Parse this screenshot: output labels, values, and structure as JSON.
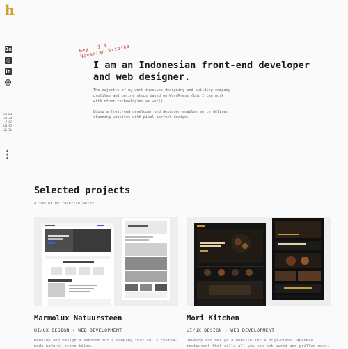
{
  "logo": "h",
  "social": [
    {
      "icon": "behance-icon",
      "glyph": "Bē"
    },
    {
      "icon": "github-icon",
      "glyph": "◎"
    },
    {
      "icon": "linkedin-icon",
      "glyph": "in"
    },
    {
      "icon": "at-icon",
      "glyph": "@"
    }
  ],
  "sidebar_vertical_text": "HELLO WORLD",
  "hero": {
    "handwritten": [
      "Hey ! I'm",
      "Nevarian Sribika"
    ],
    "headline": "I am an Indonesian front-end developer and web designer.",
    "paragraph1": "The majority of my work involves designing and building company profiles and online shops based on WordPress (but I can work with other technologies as well).",
    "paragraph2": "Being a front-end developer and designer enables me to deliver stunning websites with pixel-perfect design."
  },
  "projects": {
    "title": "Selected projects",
    "subtitle": "A few of my favorite works.",
    "items": [
      {
        "name": "Marmolux Natuursteen",
        "tags": "UI/UX DESIGN • WEB DEVELOPMENT",
        "description": "Develop and design a website for a company that sells custom-made natural stone tiles."
      },
      {
        "name": "Mori Kitchen",
        "tags": "UI/UX DESIGN • WEB DEVELOPMENT",
        "description": "Develop and design a website for a high-class Japanese restaurant that sells all you can eat sushi and grilled meat."
      }
    ]
  },
  "colors": {
    "accent": "#c9a227",
    "handwriting": "#c0392b",
    "mori_dark": "#111111",
    "mori_gold": "#c79a3a"
  }
}
